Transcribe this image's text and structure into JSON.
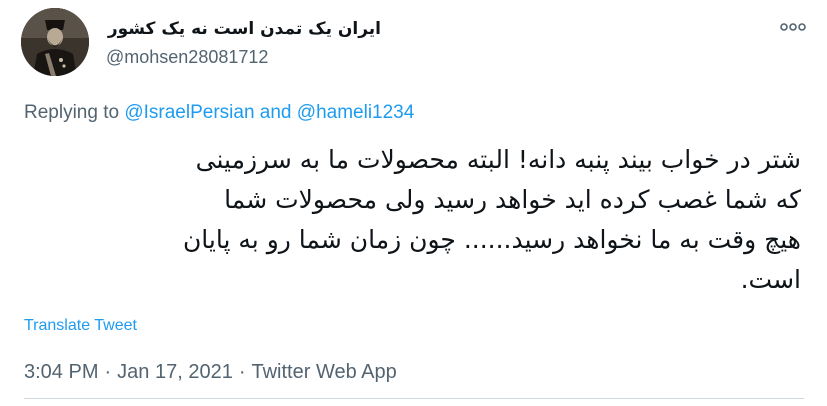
{
  "tweet": {
    "author": {
      "display_name": "ایران یک تمدن است نه یک کشور",
      "handle": "@mohsen28081712",
      "avatar_icon": "portrait-avatar-icon"
    },
    "more_icon": "more-dots-icon",
    "reply_context": {
      "prefix": "Replying to",
      "mention_1": "@IsraelPersian",
      "conjunction": "and",
      "mention_2": "@hameli1234"
    },
    "body_lines": [
      "شتر در خواب بیند پنبه دانه! البته محصولات ما به سرزمینی",
      "که شما غصب کرده اید خواهد رسید ولی محصولات شما",
      "هیچ وقت به ما نخواهد رسید...... چون زمان شما رو به پایان",
      "است."
    ],
    "translate_label": "Translate Tweet",
    "meta": {
      "time": "3:04 PM",
      "separator": "·",
      "date": "Jan 17, 2021",
      "source": "Twitter Web App"
    },
    "colors": {
      "text_primary": "#0f1419",
      "text_secondary": "#536471",
      "link_blue": "#1d9bf0",
      "divider": "#cfd9de"
    }
  }
}
